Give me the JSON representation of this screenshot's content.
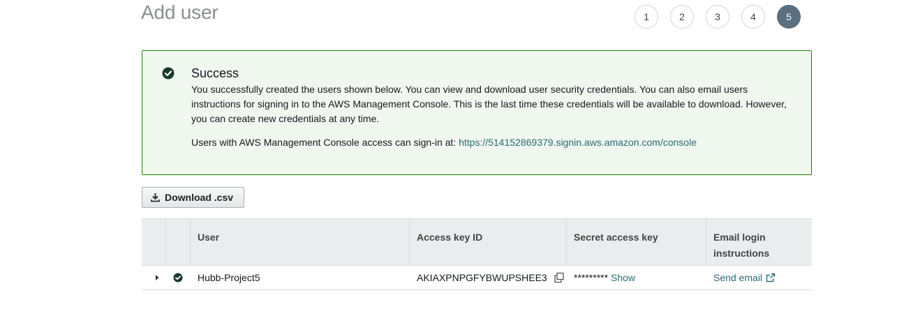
{
  "page": {
    "title": "Add user"
  },
  "steps": [
    "1",
    "2",
    "3",
    "4",
    "5"
  ],
  "active_step": 5,
  "alert": {
    "title": "Success",
    "body": "You successfully created the users shown below. You can view and download user security credentials. You can also email users instructions for signing in to the AWS Management Console. This is the last time these credentials will be available to download. However, you can create new credentials at any time.",
    "signin_prefix": "Users with AWS Management Console access can sign-in at: ",
    "signin_url": "https://514152869379.signin.aws.amazon.com/console"
  },
  "download_button": {
    "label": "Download .csv",
    "icon": "download-icon"
  },
  "table": {
    "columns": [
      "User",
      "Access key ID",
      "Secret access key",
      "Email login instructions"
    ],
    "rows": [
      {
        "user": "Hubb-Project5",
        "access_key_id": "AKIAXPNPGFYBWUPSHEE3",
        "secret_mask": "*********",
        "secret_show": "Show",
        "email_link": "Send email"
      }
    ]
  },
  "colors": {
    "success": "#1d8102",
    "link": "#2b6b78",
    "step_active": "#5a6f80"
  }
}
